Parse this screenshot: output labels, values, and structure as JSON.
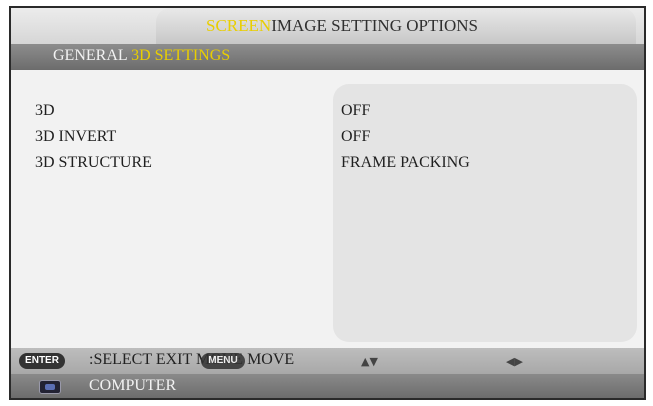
{
  "menu": {
    "main_tabs": {
      "active": "SCREEN",
      "rest": "IMAGE SETTING OPTIONS"
    },
    "sub_tabs": {
      "general": "GENERAL",
      "active": "3D SETTINGS"
    }
  },
  "settings": [
    {
      "label": "3D",
      "value": "OFF"
    },
    {
      "label": "3D INVERT",
      "value": "OFF"
    },
    {
      "label": "3D STRUCTURE",
      "value": "FRAME PACKING"
    }
  ],
  "help_bar": {
    "enter_key": "ENTER",
    "menu_key": "MENU",
    "text": ":SELECT EXIT MOVE MOVE",
    "updown_arrows": "▲▼",
    "leftright_arrows": "◀▶"
  },
  "source": {
    "icon": "vga-connector-icon",
    "label": "COMPUTER"
  },
  "colors": {
    "accent": "#e9ce00",
    "panel": "#e4e4e4",
    "bar_dark": "#6c6c6c"
  }
}
